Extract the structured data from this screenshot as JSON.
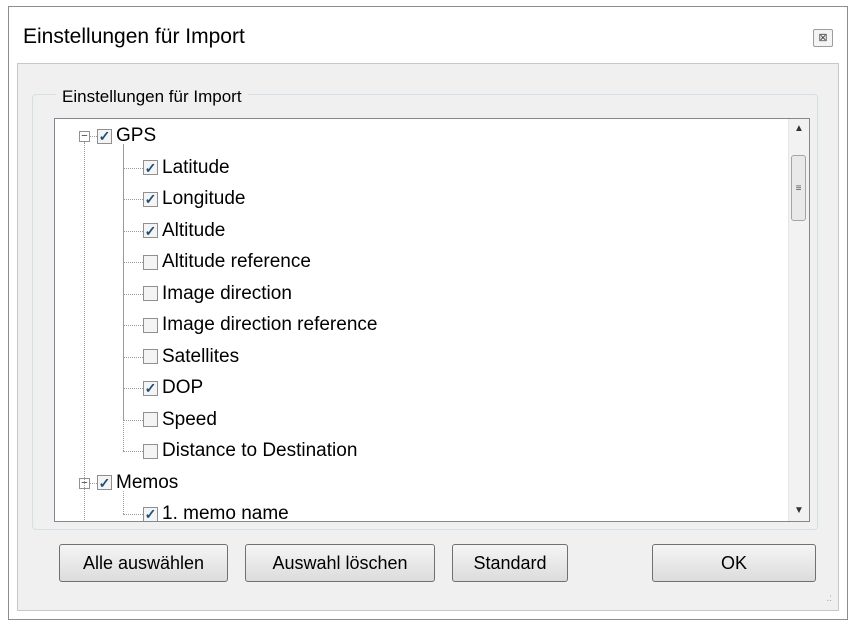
{
  "window": {
    "title": "Einstellungen für Import",
    "close_glyph": "⊠"
  },
  "groupbox": {
    "label": "Einstellungen für Import"
  },
  "tree": {
    "nodes": [
      {
        "label": "GPS",
        "checked": true,
        "expanded": true,
        "level": 0
      },
      {
        "label": "Latitude",
        "checked": true,
        "level": 1
      },
      {
        "label": "Longitude",
        "checked": true,
        "level": 1
      },
      {
        "label": "Altitude",
        "checked": true,
        "level": 1
      },
      {
        "label": "Altitude reference",
        "checked": false,
        "level": 1
      },
      {
        "label": "Image direction",
        "checked": false,
        "level": 1
      },
      {
        "label": "Image direction reference",
        "checked": false,
        "level": 1
      },
      {
        "label": "Satellites",
        "checked": false,
        "level": 1
      },
      {
        "label": "DOP",
        "checked": true,
        "level": 1
      },
      {
        "label": "Speed",
        "checked": false,
        "level": 1
      },
      {
        "label": "Distance to Destination",
        "checked": false,
        "level": 1
      },
      {
        "label": "Memos",
        "checked": true,
        "expanded": true,
        "level": 0
      },
      {
        "label": "1. memo name",
        "checked": true,
        "level": 1
      }
    ]
  },
  "buttons": {
    "select_all": "Alle auswählen",
    "clear_selection": "Auswahl löschen",
    "standard": "Standard",
    "ok": "OK"
  },
  "icons": {
    "check": "✓",
    "expander_open": "−",
    "scroll_up": "▲",
    "scroll_down": "▼",
    "scroll_grip": "≡",
    "resize_grip": ".:"
  }
}
